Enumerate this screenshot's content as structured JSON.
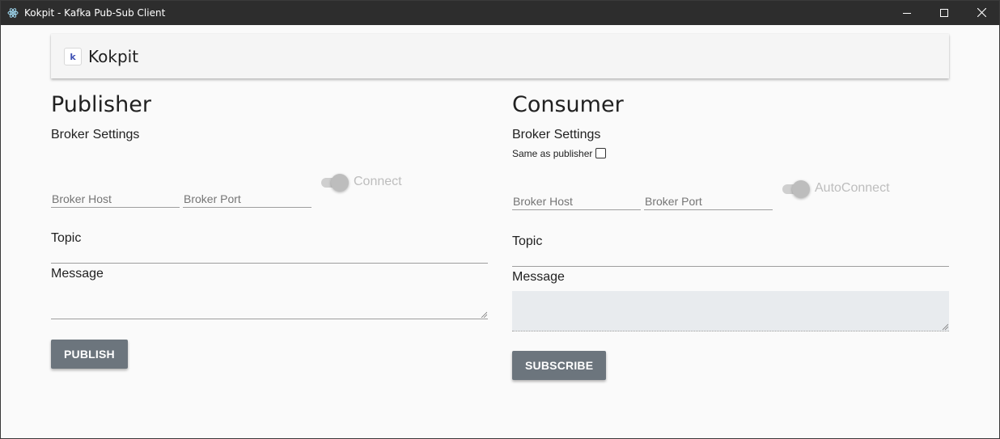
{
  "window": {
    "title": "Kokpit - Kafka Pub-Sub Client",
    "icons": {
      "app": "electron-icon",
      "minimize": "minimize-icon",
      "maximize": "maximize-icon",
      "close": "close-icon"
    }
  },
  "header": {
    "logo_icon": "kokpit-logo",
    "brand": "Kokpit",
    "logo_letter": "k"
  },
  "publisher": {
    "title": "Publisher",
    "broker_settings": "Broker Settings",
    "broker_host_placeholder": "Broker Host",
    "broker_port_placeholder": "Broker Port",
    "connect_label": "Connect",
    "connect_on": false,
    "topic_label": "Topic",
    "topic_value": "",
    "message_label": "Message",
    "message_value": "",
    "button_label": "PUBLISH"
  },
  "consumer": {
    "title": "Consumer",
    "broker_settings": "Broker Settings",
    "same_as_publisher_label": "Same as publisher",
    "same_as_publisher_checked": false,
    "broker_host_placeholder": "Broker Host",
    "broker_port_placeholder": "Broker Port",
    "autoconnect_label": "AutoConnect",
    "autoconnect_on": false,
    "topic_label": "Topic",
    "topic_value": "",
    "message_label": "Message",
    "message_value": "",
    "button_label": "SUBSCRIBE"
  },
  "colors": {
    "titlebar": "#2d2d2d",
    "button": "#6c757d",
    "toggle_disabled": "#bdbdbd",
    "logo_accent": "#3f51b5",
    "consumer_message_bg": "#e8ebee"
  }
}
